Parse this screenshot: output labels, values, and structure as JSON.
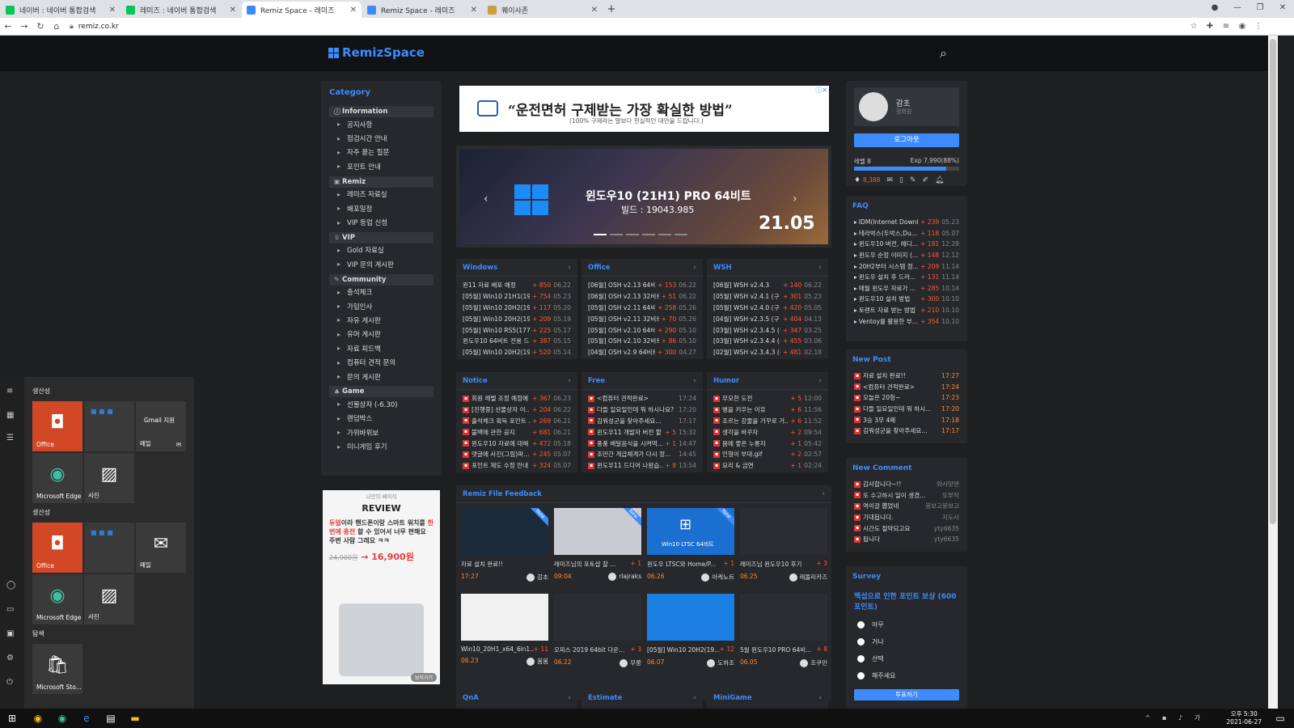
{
  "browser": {
    "tabs": [
      {
        "title": "네이버 : 네이버 통합검색",
        "color": "#03c75a",
        "active": false
      },
      {
        "title": "레미즈 : 네이버 통합검색",
        "color": "#03c75a",
        "active": false
      },
      {
        "title": "Remiz Space - 레미즈",
        "color": "#3d8bfd",
        "active": true
      },
      {
        "title": "Remiz Space - 레미즈",
        "color": "#3d8bfd",
        "active": false
      },
      {
        "title": "퀘이사존",
        "color": "#c8a03c",
        "active": false
      }
    ],
    "url": "remiz.co.kr"
  },
  "site": {
    "logo": "RemizSpace",
    "category": {
      "title": "Category",
      "groups": [
        {
          "label": "Information",
          "items": [
            "공지사항",
            "점검시간 안내",
            "자주 묻는 질문",
            "포인트 안내"
          ]
        },
        {
          "label": "Remiz",
          "items": [
            "레미즈 자료실",
            "배포일정",
            "VIP 등업 신청"
          ]
        },
        {
          "label": "VIP",
          "items": [
            "Gold 자료실",
            "VIP 문의 게시판"
          ]
        },
        {
          "label": "Community",
          "items": [
            "출석체크",
            "가입인사",
            "자유 게시판",
            "유머 게시판",
            "자료 피드백",
            "컴퓨터 견적 문의",
            "문의 게시판"
          ]
        },
        {
          "label": "Game",
          "items": [
            "선물상자 (-6.30)",
            "랜덤박스",
            "가위바위보",
            "미니게임 후기"
          ]
        }
      ]
    },
    "ad_top": {
      "headline": "“운전면허 구제받는 가장 확실한 방법”",
      "sub": "(100% 구제라는 말보다 현실적인 대안을 드립니다.)"
    },
    "banner": {
      "title": "윈도우10 (21H1) PRO 64비트",
      "build": "빌드 : 19043.985",
      "version": "21.05"
    },
    "boards_row1": [
      {
        "title": "Windows",
        "rows": [
          {
            "t": "윈11 자료 배포 예정",
            "c": "+ 850",
            "d": "06.22"
          },
          {
            "t": "[05월] Win10 21H1(1904...",
            "c": "+ 754",
            "d": "05.23"
          },
          {
            "t": "[05월] Win10 20H2(1904...",
            "c": "+ 117",
            "d": "05.20"
          },
          {
            "t": "[05월] Win10 20H2(1904...",
            "c": "+ 209",
            "d": "05.19"
          },
          {
            "t": "[05월] Win10 RS5(17763.1...",
            "c": "+ 225",
            "d": "05.17"
          },
          {
            "t": "윈도우10 64비트 전용 드...",
            "c": "+ 387",
            "d": "05.15"
          },
          {
            "t": "[05월] Win10 20H2(1904...",
            "c": "+ 520",
            "d": "05.14"
          }
        ]
      },
      {
        "title": "Office",
        "rows": [
          {
            "t": "[06월] OSH v2.13 64비트 ...",
            "c": "+ 153",
            "d": "06.22"
          },
          {
            "t": "[06월] OSH v2.13 32비트 (...",
            "c": "+ 51",
            "d": "06.22"
          },
          {
            "t": "[05월] OSH v2.11 64비트 ...",
            "c": "+ 258",
            "d": "05.26"
          },
          {
            "t": "[05월] OSH v2.11 32비트 (...",
            "c": "+ 70",
            "d": "05.26"
          },
          {
            "t": "[05월] OSH v2.10 64비트 ...",
            "c": "+ 290",
            "d": "05.10"
          },
          {
            "t": "[05월] OSH v2.10 32비트 (...",
            "c": "+ 86",
            "d": "05.10"
          },
          {
            "t": "[04월] OSH v2.9 64비트 ...",
            "c": "+ 300",
            "d": "04.27"
          }
        ]
      },
      {
        "title": "WSH",
        "rows": [
          {
            "t": "[06월] WSH v2.4.3",
            "c": "+ 140",
            "d": "06.22"
          },
          {
            "t": "[05월] WSH v2.4.1 (구 윈...",
            "c": "+ 301",
            "d": "05.23"
          },
          {
            "t": "[05월] WSH v2.4.0 (구 윈...",
            "c": "+ 420",
            "d": "05.05"
          },
          {
            "t": "[04월] WSH v2.3.5 (구 윈...",
            "c": "+ 404",
            "d": "04.13"
          },
          {
            "t": "[03월] WSH v2.3.4.5 (구 ...",
            "c": "+ 347",
            "d": "03.25"
          },
          {
            "t": "[03월] WSH v2.3.4.4 (구 ...",
            "c": "+ 455",
            "d": "03.06"
          },
          {
            "t": "[02월] WSH v2.3.4.3 (구 ...",
            "c": "+ 481",
            "d": "02.18"
          }
        ]
      }
    ],
    "boards_row2": [
      {
        "title": "Notice",
        "rows": [
          {
            "t": "회원 레벨 조정 예정에 ...",
            "c": "+ 367",
            "d": "06.23"
          },
          {
            "t": "[진행중] 선물상자 이...",
            "c": "+ 204",
            "d": "06.22"
          },
          {
            "t": "출석체크 획득 포인트 ...",
            "c": "+ 269",
            "d": "06.21"
          },
          {
            "t": "불백에 관한 공지",
            "c": "+ 681",
            "d": "06.21"
          },
          {
            "t": "윈도우10 자료에 대해 ...",
            "c": "+ 472",
            "d": "05.18"
          },
          {
            "t": "댓글에 사진(그림)파...",
            "c": "+ 245",
            "d": "05.07"
          },
          {
            "t": "포인트 제도 수정 안내",
            "c": "+ 324",
            "d": "05.07"
          }
        ]
      },
      {
        "title": "Free",
        "rows": [
          {
            "t": "<컴퓨터 견적완료>",
            "c": "",
            "d": "17:24"
          },
          {
            "t": "다들 일요일인데 뭐 하시나요?",
            "c": "",
            "d": "17:20"
          },
          {
            "t": "김워성군을 찾아주세요...",
            "c": "",
            "d": "17:17"
          },
          {
            "t": "윈도우11 개발자 버전 할 ...",
            "c": "+ 5",
            "d": "15:32"
          },
          {
            "t": "풍풍 배달음식을 시켜먹...",
            "c": "+ 1",
            "d": "14:47"
          },
          {
            "t": "조만간 게급체계가 다시 정...",
            "c": "",
            "d": "14:45"
          },
          {
            "t": "윈도우11 드디어 나왔습...",
            "c": "+ 8",
            "d": "13:54"
          }
        ]
      },
      {
        "title": "Humor",
        "rows": [
          {
            "t": "무모한 도전",
            "c": "+ 5",
            "d": "12:00"
          },
          {
            "t": "병을 키우는 이유",
            "c": "+ 6",
            "d": "11:56"
          },
          {
            "t": "조르는 강물을 거꾸로 거...",
            "c": "+ 6",
            "d": "11:52"
          },
          {
            "t": "생각을 바꾸자",
            "c": "+ 2",
            "d": "09:54"
          },
          {
            "t": "몸에 좋은 누룽지",
            "c": "+ 1",
            "d": "05:42"
          },
          {
            "t": "인형이 부대.gif",
            "c": "+ 2",
            "d": "02:57"
          },
          {
            "t": "요리 & 금연",
            "c": "+ 1",
            "d": "02:24"
          }
        ]
      }
    ],
    "feedback": {
      "title": "Remiz File Feedback",
      "items": [
        {
          "t": "자료 설치 완료!!",
          "c": "",
          "d": "17:27",
          "a": "감초",
          "img": "#1b2b3b",
          "new": true
        },
        {
          "t": "레미즈님의 포토샵 잘 ...",
          "c": "+ 1",
          "d": "09:04",
          "a": "rlajraks",
          "img": "#c8ccd2",
          "new": true
        },
        {
          "t": "윈도우 LTSC와 Home/P...",
          "c": "+ 1",
          "d": "06.26",
          "a": "아케노트",
          "img": "#1b6fd1",
          "new": true,
          "label": "Win10 LTSC 64비트"
        },
        {
          "t": "레미즈님 윈도우10 후기",
          "c": "+ 3",
          "d": "06.25",
          "a": "레몰리카즈",
          "img": "#2b2d30",
          "new": false
        },
        {
          "t": "Win10_20H1_x64_6in1...",
          "c": "+ 11",
          "d": "06.23",
          "a": "봄봄",
          "img": "#f0f0f0",
          "new": false
        },
        {
          "t": "오피스 2019 64bit 다운...",
          "c": "+ 3",
          "d": "06.22",
          "a": "무쫑",
          "img": "#2b2d30",
          "new": false
        },
        {
          "t": "[05월] Win10 20H2(19...",
          "c": "+ 12",
          "d": "06.07",
          "a": "도하조",
          "img": "#1a7fe0",
          "new": false
        },
        {
          "t": "5월 윈도우10 PRO 64비...",
          "c": "+ 8",
          "d": "06.05",
          "a": "조쿠만",
          "img": "#2b2d30",
          "new": false
        }
      ]
    },
    "bottom_boards": [
      "QnA",
      "Estimate",
      "MiniGame"
    ],
    "profile": {
      "name": "감초",
      "rank": "정회원",
      "logout": "로그아웃",
      "level": "레벨 8",
      "exp": "Exp 7,990(88%)",
      "exp_ratio": 0.88,
      "points": "8,388"
    },
    "faq": {
      "title": "FAQ",
      "rows": [
        {
          "t": "IDM(Internet Downl...",
          "c": "+ 239",
          "d": "05.23"
        },
        {
          "t": "테라박스(두박스,Du...",
          "c": "+ 118",
          "d": "05.07"
        },
        {
          "t": "윈도우10 버전, 에디...",
          "c": "+ 181",
          "d": "12.28"
        },
        {
          "t": "윈도우 순정 이미지 (...",
          "c": "+ 148",
          "d": "12.12"
        },
        {
          "t": "20H2부터 시스템 정...",
          "c": "+ 209",
          "d": "11.14"
        },
        {
          "t": "윈도우 설치 후 드라...",
          "c": "+ 131",
          "d": "11.14"
        },
        {
          "t": "매월 윈도우 자료가 ...",
          "c": "+ 285",
          "d": "10.14"
        },
        {
          "t": "윈도우10 설치 방법",
          "c": "+ 300",
          "d": "10.10"
        },
        {
          "t": "토렌트 자료 받는 방법",
          "c": "+ 210",
          "d": "10.10"
        },
        {
          "t": "Ventoy를 활용한 부...",
          "c": "+ 354",
          "d": "10.10"
        }
      ]
    },
    "new_post": {
      "title": "New Post",
      "rows": [
        {
          "t": "자료 설치 완료!!",
          "d": "17:27"
        },
        {
          "t": "<컴퓨터 견적완료>",
          "d": "17:24"
        },
        {
          "t": "오늘은 20헝~",
          "d": "17:23"
        },
        {
          "t": "다들 일요일인데 뭐 하시...",
          "d": "17:20"
        },
        {
          "t": "3승 3무 4패",
          "d": "17:18"
        },
        {
          "t": "김워성군을 찾아주세요...",
          "d": "17:17"
        }
      ]
    },
    "new_comment": {
      "title": "New Comment",
      "rows": [
        {
          "t": "감사합니다~!!",
          "d": "와사앙맨"
        },
        {
          "t": "또 수고하시 일이 생겼...",
          "d": "또부작"
        },
        {
          "t": "역이갈 뽑었네",
          "d": "봉보고봉보고"
        },
        {
          "t": "기대됩니다.",
          "d": "지도사"
        },
        {
          "t": "시간도 절약되고요",
          "d": "yty6635"
        },
        {
          "t": "됩니다",
          "d": "yty6635"
        }
      ]
    },
    "survey": {
      "title": "Survey",
      "question": "백섭으로 인한 포인트 보상 (600포인트)",
      "options": [
        "아무",
        "거나",
        "선택",
        "해주세요"
      ],
      "button": "투표하기"
    },
    "ad_side": {
      "tag": "나만의 베이직",
      "title": "REVIEW",
      "desc_red": "듀얼",
      "desc1": "이라 핸드폰이랑 스마트 워치를",
      "desc_red2": "한번에 충전",
      "desc2": " 할 수 있어서 너무 편해요 주변 사람 그래요 ㅋㅋ",
      "old_price": "24,900원",
      "price": "16,900원",
      "more": "보러가기"
    }
  },
  "startmenu": {
    "section1": "생산성",
    "section2": "생산성",
    "section3": "탐색",
    "tiles": {
      "office": "Office",
      "gmail": "Gmail 지원",
      "mail": "메일",
      "edge": "Microsoft Edge",
      "photos": "사진",
      "store": "Microsoft Sto..."
    }
  },
  "taskbar": {
    "time": "오후 5:30",
    "date": "2021-06-27"
  }
}
